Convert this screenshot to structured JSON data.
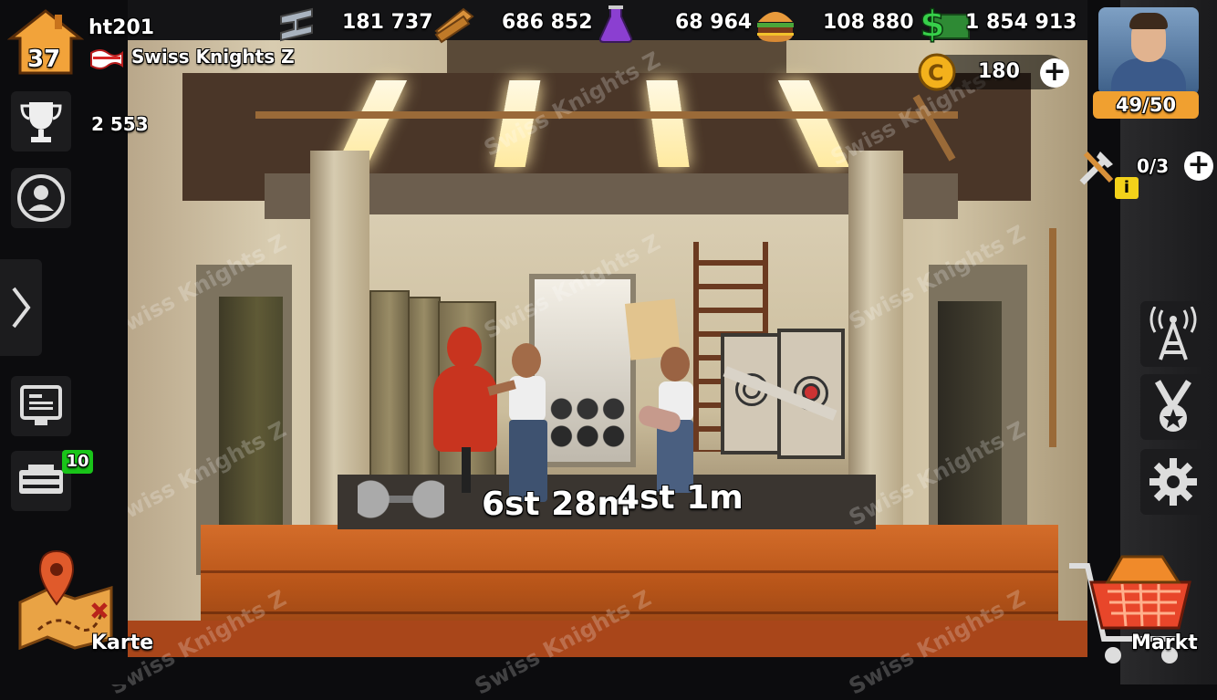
{
  "player": {
    "name": "ht201",
    "level": "37",
    "alliance": "Swiss Knights Z",
    "trophies": "2 553"
  },
  "resources": {
    "steel": "181 737",
    "wood": "686 852",
    "potion": "68 964",
    "food": "108 880",
    "cash": "1 854 913"
  },
  "coins": "180",
  "survivors": "49/50",
  "builders": "0/3",
  "builders_info_icon": "i",
  "garage_badge": "10",
  "timers": [
    "6st 28m",
    "4st 1m"
  ],
  "map_label": "Karte",
  "market_label": "Markt",
  "watermark": "Swiss Knights Z",
  "icons": {
    "trophy": "trophy-icon",
    "alliance": "people-icon",
    "expand": "chevron-right-icon",
    "news": "monitor-icon",
    "garage": "vehicle-icon",
    "radio": "radio-tower-icon",
    "medal": "medal-icon",
    "settings": "gear-icon",
    "map": "map-icon",
    "market": "cart-icon"
  },
  "colors": {
    "cash": "#37d04a",
    "badge": "#19c419",
    "survivor_bar": "#f0a030",
    "floor": "#c45e20"
  }
}
